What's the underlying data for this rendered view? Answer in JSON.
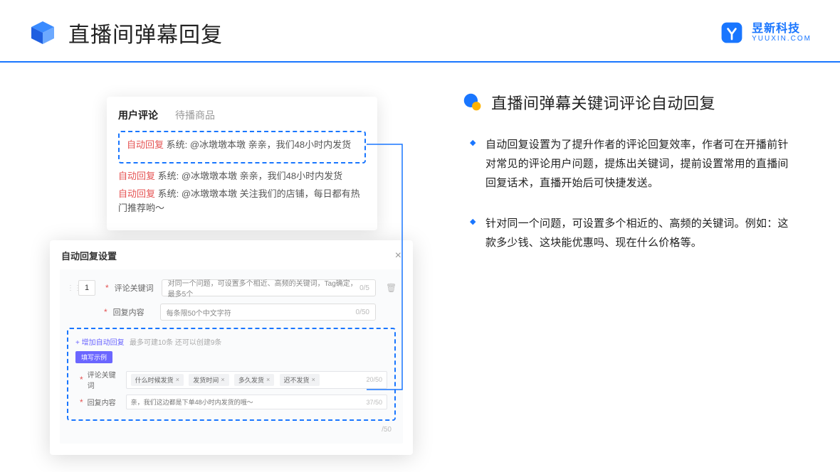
{
  "header": {
    "title": "直播间弹幕回复",
    "brand_name": "昱新科技",
    "brand_url": "YUUXIN.COM"
  },
  "comments_card": {
    "tab_active": "用户评论",
    "tab_other": "待播商品",
    "highlight_line": "自动回复 系统: @冰墩墩本墩 亲亲，我们48小时内发货",
    "line2": "自动回复 系统: @冰墩墩本墩 亲亲，我们48小时内发货",
    "line3": "自动回复 系统: @冰墩墩本墩 关注我们的店铺，每日都有热门推荐哟～",
    "tag": "自动回复",
    "sys": "系统:"
  },
  "settings_card": {
    "title": "自动回复设置",
    "seq": "1",
    "kw_label": "评论关键词",
    "kw_placeholder": "对同一个问题，可设置多个相近、高频的关键词，Tag确定，最多5个",
    "kw_counter": "0/5",
    "content_label": "回复内容",
    "content_placeholder": "每条限50个中文字符",
    "content_counter": "0/50",
    "add_link": "+ 增加自动回复",
    "add_hint": "最多可建10条 还可以创建9条",
    "example_chip": "填写示例",
    "ex_kw_label": "评论关键词",
    "ex_tags": [
      "什么时候发货",
      "发货时间",
      "多久发货",
      "迟不发货"
    ],
    "ex_kw_counter": "20/50",
    "ex_content_label": "回复内容",
    "ex_content_text": "亲，我们这边都是下单48小时内发货的哦～",
    "ex_content_counter": "37/50",
    "outer_counter": "/50"
  },
  "right": {
    "section_title": "直播间弹幕关键词评论自动回复",
    "bullet1": "自动回复设置为了提升作者的评论回复效率，作者可在开播前针对常见的评论用户问题，提炼出关键词，提前设置常用的直播间回复话术，直播开始后可快捷发送。",
    "bullet2": "针对同一个问题，可设置多个相近的、高频的关键词。例如：这款多少钱、这块能优惠吗、现在什么价格等。"
  }
}
